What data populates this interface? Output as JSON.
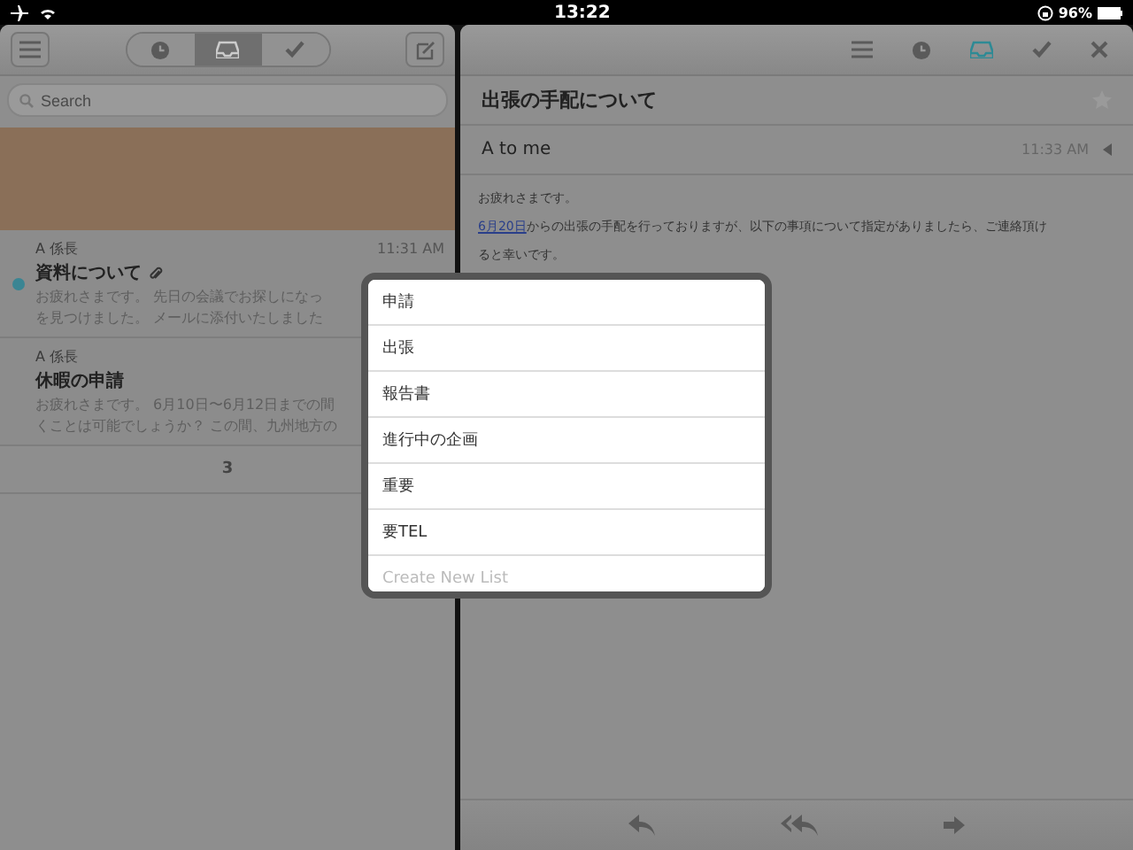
{
  "status_bar": {
    "time": "13:22",
    "battery": "96%"
  },
  "list_pane": {
    "toolbar": [
      {
        "kind": "clock",
        "selected": false
      },
      {
        "kind": "inbox",
        "selected": true
      },
      {
        "kind": "check",
        "selected": false
      }
    ],
    "search": {
      "placeholder": "Search"
    },
    "messages": [
      {
        "sender": "A 係長",
        "time": "11:31 AM",
        "subject": "資料について",
        "unread": true,
        "attachment": true,
        "preview": [
          "お疲れさまです。 先日の会議でお探しになっ",
          "を見つけました。 メールに添付いたしました"
        ]
      },
      {
        "sender": "A 係長",
        "subject": "休暇の申請",
        "unread": false,
        "attachment": false,
        "preview": [
          "お疲れさまです。 6月10日〜6月12日までの間",
          "くことは可能でしょうか？ この間、九州地方の"
        ]
      }
    ],
    "page_count": "3"
  },
  "message_pane": {
    "toolbar": [
      {
        "kind": "menu",
        "selected": false
      },
      {
        "kind": "clock",
        "selected": false
      },
      {
        "kind": "inbox",
        "selected": true
      },
      {
        "kind": "check",
        "selected": false
      },
      {
        "kind": "close",
        "selected": false
      }
    ],
    "subject": "出張の手配について",
    "starred": false,
    "from": "A to me",
    "time": "11:33 AM",
    "body": [
      {
        "text": "お疲れさまです。"
      },
      {
        "link": "6月20日",
        "text": "からの出張の手配を行っておりますが、以下の事項について指定がありましたら、ご連絡頂け"
      },
      {
        "text": "ると幸いです。"
      }
    ]
  },
  "list_picker": {
    "items": [
      {
        "label": "申請",
        "kind": "list"
      },
      {
        "label": "出張",
        "kind": "list"
      },
      {
        "label": "報告書",
        "kind": "list"
      },
      {
        "label": "進行中の企画",
        "kind": "list"
      },
      {
        "label": "重要",
        "kind": "list"
      },
      {
        "label": "要TEL",
        "kind": "list"
      },
      {
        "label": "Create New List",
        "kind": "action"
      }
    ]
  }
}
